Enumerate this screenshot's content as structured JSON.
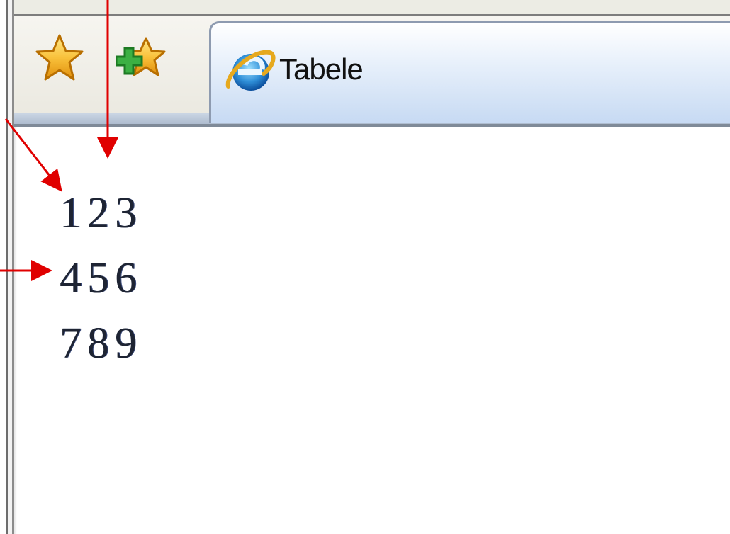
{
  "tab": {
    "title": "Tabele",
    "icon": "internet-explorer-icon"
  },
  "toolbar": {
    "favorites_icon": "favorites-star-icon",
    "add_favorites_icon": "add-to-favorites-icon"
  },
  "table": {
    "rows": [
      [
        "1",
        "2",
        "3"
      ],
      [
        "4",
        "5",
        "6"
      ],
      [
        "7",
        "8",
        "9"
      ]
    ]
  },
  "colors": {
    "annotation_arrow": "#e00000",
    "tab_gradient_end": "#c7daf3",
    "star": "#f7b731"
  }
}
